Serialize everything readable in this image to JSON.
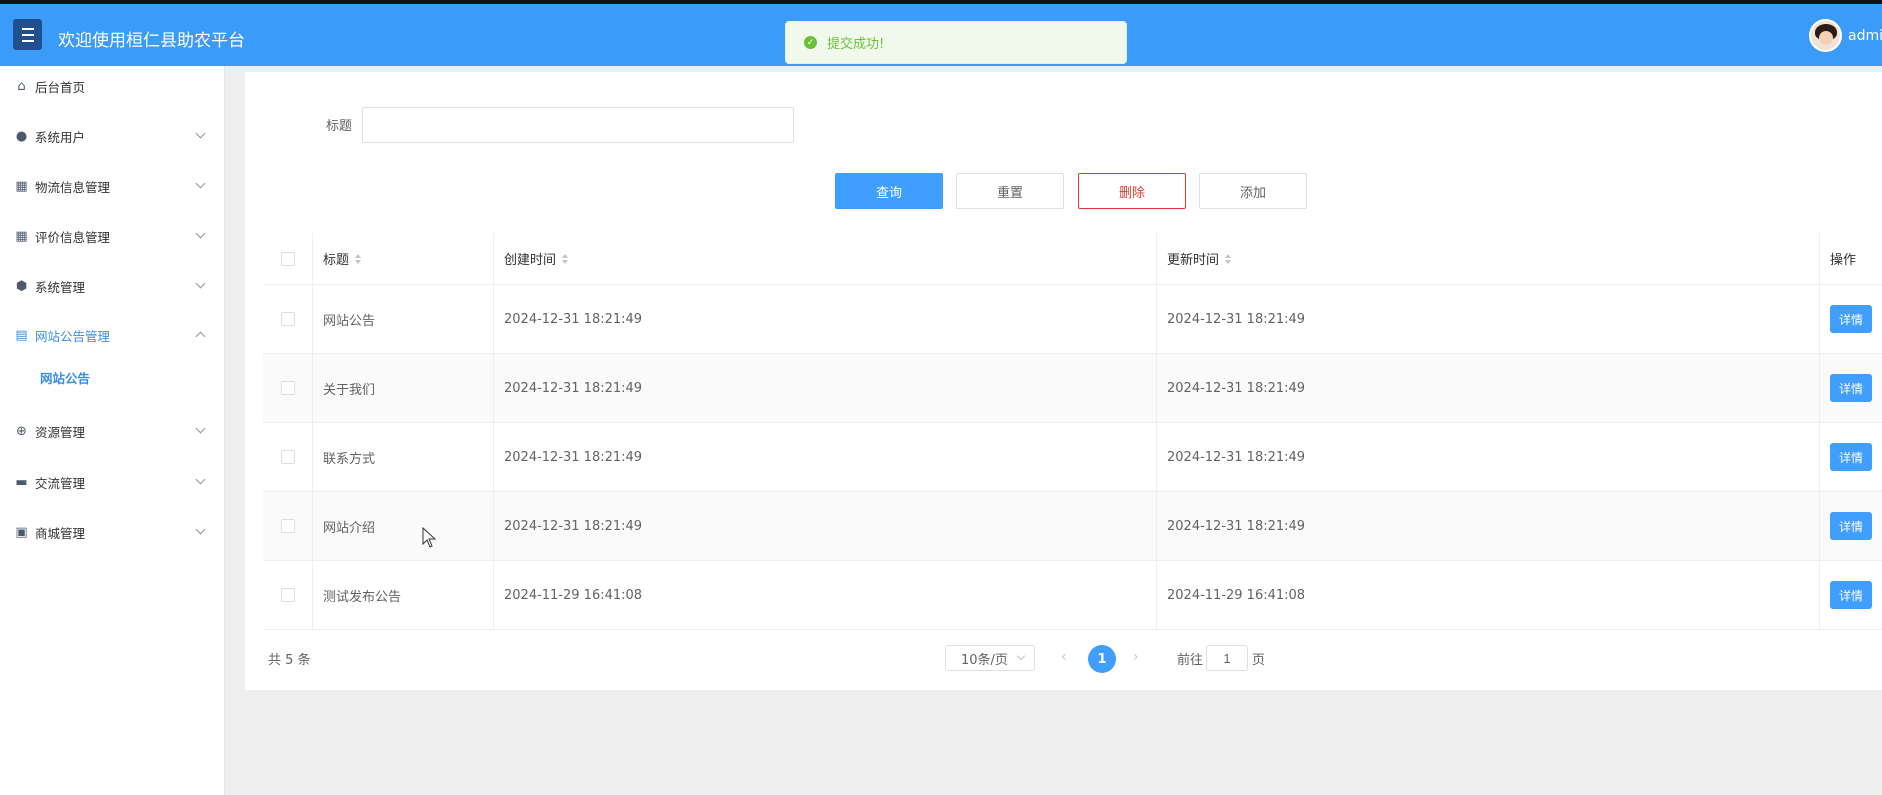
{
  "header": {
    "title": "欢迎使用桓仁县助农平台",
    "username": "admi",
    "menu_icon": "hamburger-icon",
    "brand_color": "#3a9bf9"
  },
  "toast": {
    "message": "提交成功!",
    "type": "success",
    "icon": "check-circle-icon"
  },
  "sidebar": {
    "items": [
      {
        "label": "后台首页",
        "icon": "home-icon",
        "expandable": false
      },
      {
        "label": "系统用户",
        "icon": "user-icon",
        "expandable": true
      },
      {
        "label": "物流信息管理",
        "icon": "dashboard-icon",
        "expandable": true
      },
      {
        "label": "评价信息管理",
        "icon": "dashboard-icon",
        "expandable": true
      },
      {
        "label": "系统管理",
        "icon": "gear-icon",
        "expandable": true
      },
      {
        "label": "网站公告管理",
        "icon": "document-icon",
        "expandable": true,
        "expanded": true,
        "active": true
      },
      {
        "label": "资源管理",
        "icon": "plus-circle-icon",
        "expandable": true
      },
      {
        "label": "交流管理",
        "icon": "chat-icon",
        "expandable": true
      },
      {
        "label": "商城管理",
        "icon": "shop-icon",
        "expandable": true
      }
    ],
    "subitem": "网站公告"
  },
  "search": {
    "label": "标题",
    "value": ""
  },
  "toolbar": {
    "query": "查询",
    "reset": "重置",
    "delete": "删除",
    "add": "添加"
  },
  "table": {
    "columns": {
      "title": "标题",
      "created": "创建时间",
      "updated": "更新时间",
      "ops": "操作"
    },
    "rows": [
      {
        "title": "网站公告",
        "created": "2024-12-31 18:21:49",
        "updated": "2024-12-31 18:21:49",
        "action": "详情"
      },
      {
        "title": "关于我们",
        "created": "2024-12-31 18:21:49",
        "updated": "2024-12-31 18:21:49",
        "action": "详情"
      },
      {
        "title": "联系方式",
        "created": "2024-12-31 18:21:49",
        "updated": "2024-12-31 18:21:49",
        "action": "详情"
      },
      {
        "title": "网站介绍",
        "created": "2024-12-31 18:21:49",
        "updated": "2024-12-31 18:21:49",
        "action": "详情"
      },
      {
        "title": "测试发布公告",
        "created": "2024-11-29 16:41:08",
        "updated": "2024-11-29 16:41:08",
        "action": "详情"
      }
    ]
  },
  "pagination": {
    "total": "共 5 条",
    "page_size": "10条/页",
    "current_page": "1",
    "goto_label": "前往",
    "goto_value": "1",
    "goto_suffix": "页"
  }
}
